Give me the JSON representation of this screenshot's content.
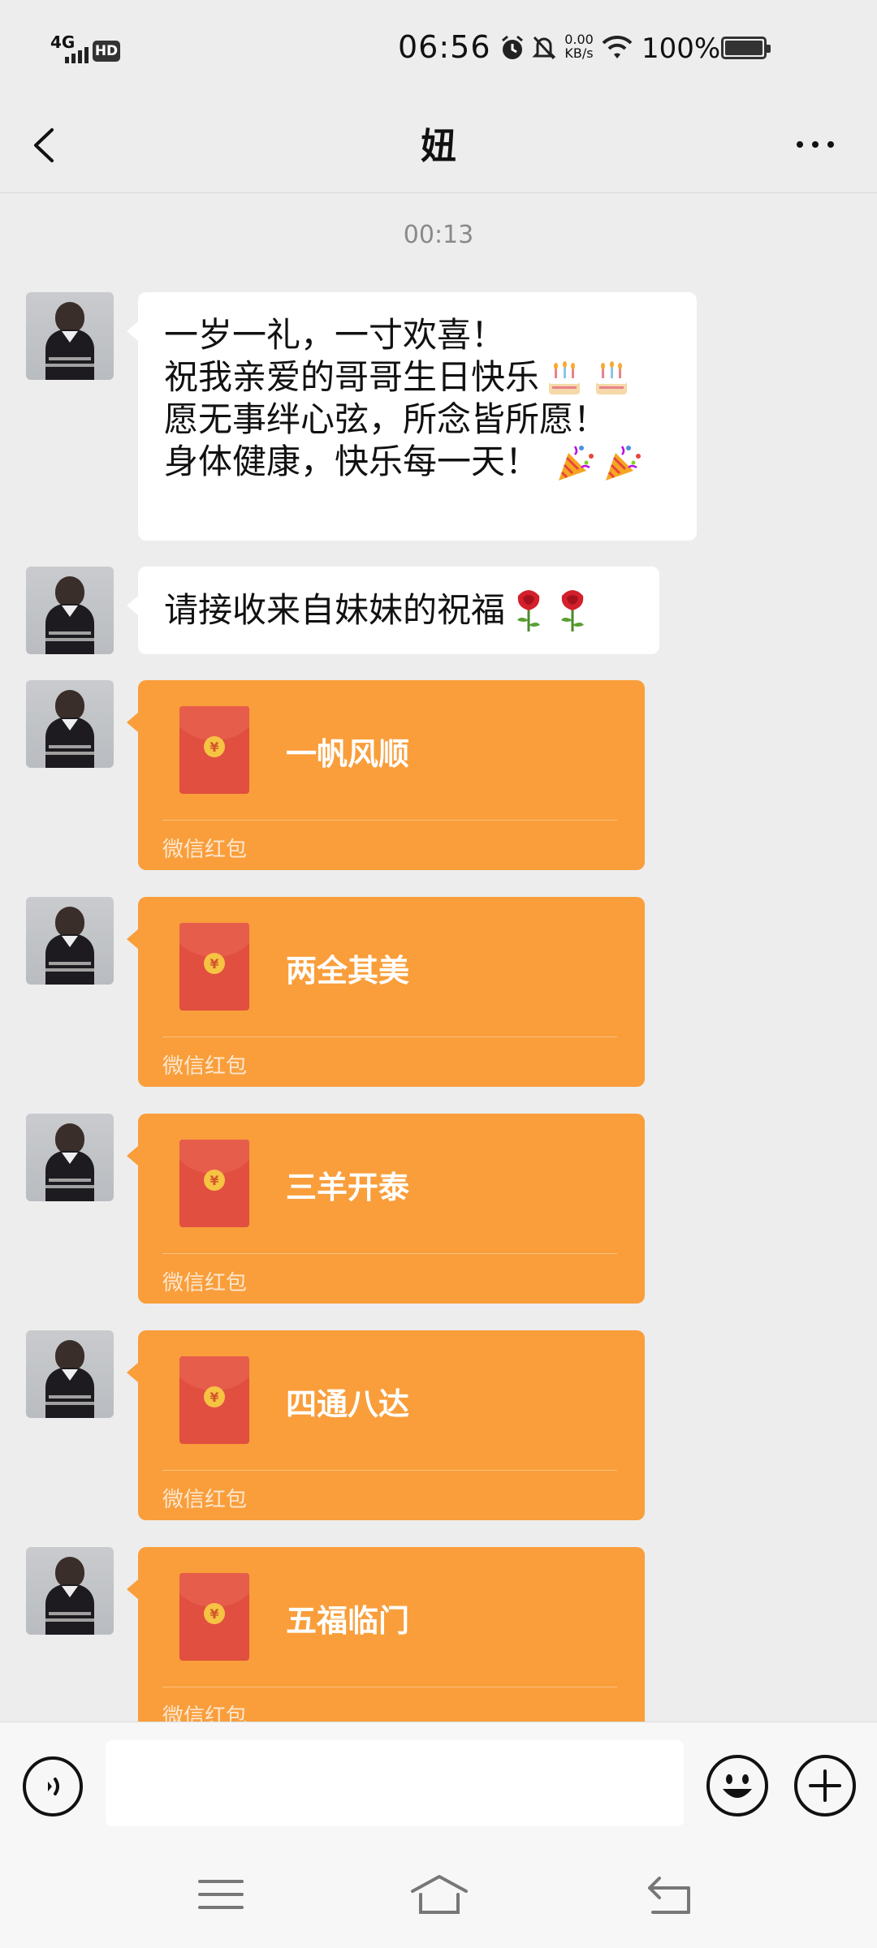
{
  "status_bar": {
    "network": "4G",
    "hd": "HD",
    "time": "06:56",
    "speed_value": "0.00",
    "speed_unit": "KB/s",
    "battery": "100%"
  },
  "nav": {
    "title": "妞"
  },
  "timestamp": "00:13",
  "messages": {
    "greeting_lines": [
      "一岁一礼，一寸欢喜！",
      "祝我亲爱的哥哥生日快乐",
      "愿无事绊心弦，所念皆所愿！",
      "身体健康，快乐每一天！"
    ],
    "wish": "请接收来自妹妹的祝福"
  },
  "red_packets": [
    {
      "title": "一帆风顺",
      "label": "微信红包"
    },
    {
      "title": "两全其美",
      "label": "微信红包"
    },
    {
      "title": "三羊开泰",
      "label": "微信红包"
    },
    {
      "title": "四通八达",
      "label": "微信红包"
    },
    {
      "title": "五福临门",
      "label": "微信红包"
    }
  ],
  "icons": {
    "coin_symbol": "¥",
    "colors": {
      "packet": "#f99e3b",
      "envelope": "#e14f40",
      "coin": "#f6c343"
    }
  }
}
